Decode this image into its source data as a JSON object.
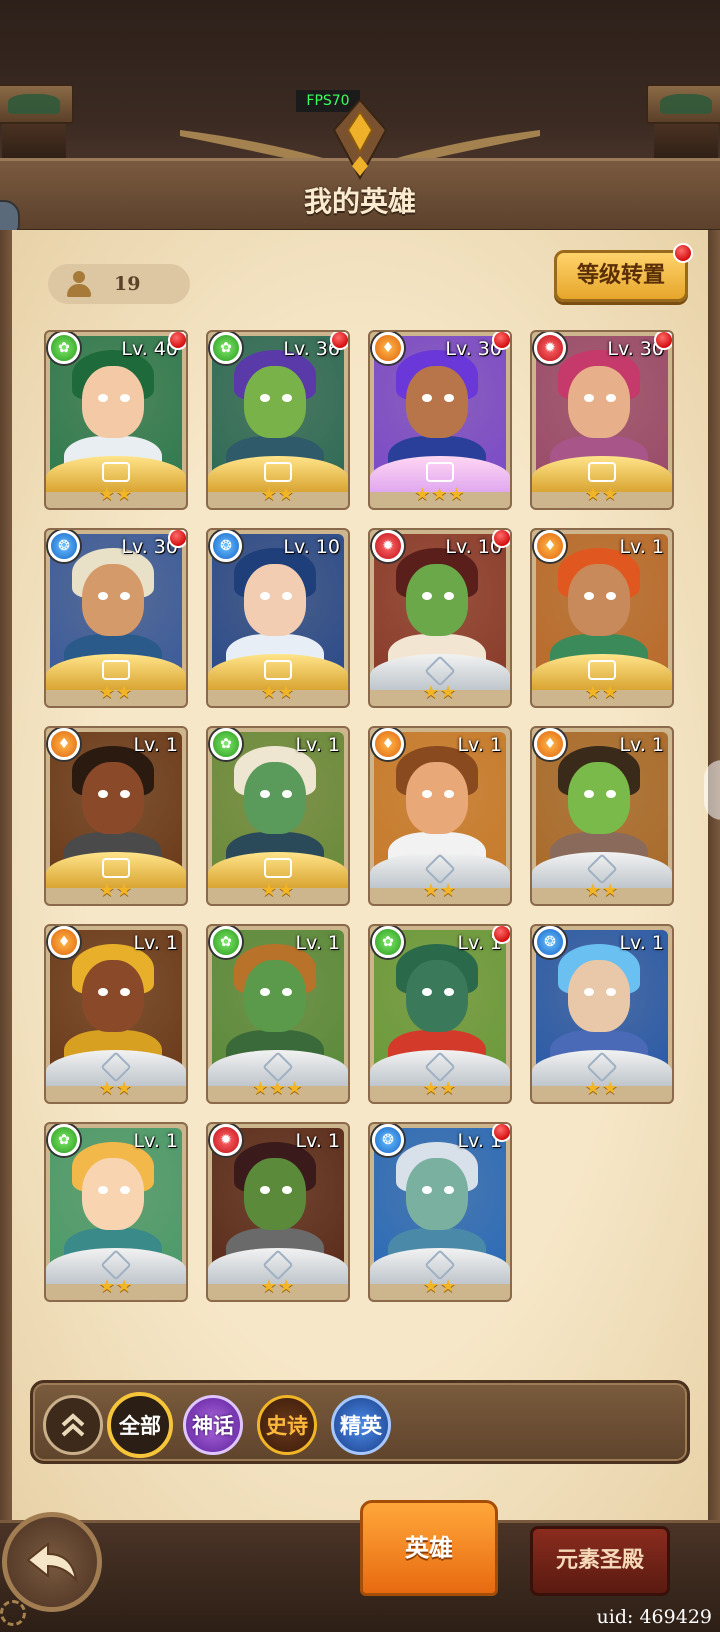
{
  "fps_label": "FPS70",
  "page_title": "我的英雄",
  "hero_count": "19",
  "level_reset_label": "等级转置",
  "heroes": [
    {
      "level": "Lv. 40",
      "element": "nature",
      "element_icon": "leaf-icon",
      "stars": "★★",
      "frame": "gold",
      "new_dot": true,
      "colors": {
        "bg": "#2f7a4f",
        "hair": "#1f6a3a",
        "face": "#f3c9a6",
        "body": "#e9eef2"
      }
    },
    {
      "level": "Lv. 36",
      "element": "nature",
      "element_icon": "leaf-icon",
      "stars": "★★",
      "frame": "gold",
      "new_dot": true,
      "colors": {
        "bg": "#2d6a56",
        "hair": "#5a3aa8",
        "face": "#7ab24a",
        "body": "#2f5a6a"
      }
    },
    {
      "level": "Lv. 30",
      "element": "fire",
      "element_icon": "flame-icon",
      "stars": "★★★",
      "frame": "pink",
      "new_dot": true,
      "colors": {
        "bg": "#7a4ac8",
        "hair": "#6a38d8",
        "face": "#b8754a",
        "body": "#2a3f9a"
      }
    },
    {
      "level": "Lv. 30",
      "element": "dark",
      "element_icon": "drop-icon",
      "stars": "★★",
      "frame": "gold",
      "new_dot": true,
      "colors": {
        "bg": "#9a4a6a",
        "hair": "#c53a6a",
        "face": "#e8b08a",
        "body": "#a8558a"
      }
    },
    {
      "level": "Lv. 30",
      "element": "water",
      "element_icon": "water-icon",
      "stars": "★★",
      "frame": "gold",
      "new_dot": true,
      "colors": {
        "bg": "#3a5a9a",
        "hair": "#e9e0c8",
        "face": "#d49a6a",
        "body": "#2a5a8a"
      }
    },
    {
      "level": "Lv. 10",
      "element": "water",
      "element_icon": "water-icon",
      "stars": "★★",
      "frame": "gold",
      "new_dot": false,
      "colors": {
        "bg": "#2a4a8a",
        "hair": "#1f3f7a",
        "face": "#f2cdb2",
        "body": "#e8eef5"
      }
    },
    {
      "level": "Lv. 10",
      "element": "dark",
      "element_icon": "drop-icon",
      "stars": "★★",
      "frame": "silver",
      "new_dot": true,
      "colors": {
        "bg": "#8a3a2a",
        "hair": "#5a1f1a",
        "face": "#6aa84a",
        "body": "#f2e6d2"
      }
    },
    {
      "level": "Lv. 1",
      "element": "fire",
      "element_icon": "flame-icon",
      "stars": "★★",
      "frame": "gold",
      "new_dot": false,
      "colors": {
        "bg": "#b86a2a",
        "hair": "#e0581f",
        "face": "#c88a5a",
        "body": "#3a8a5a"
      }
    },
    {
      "level": "Lv. 1",
      "element": "fire",
      "element_icon": "flame-icon",
      "stars": "★★",
      "frame": "gold",
      "new_dot": false,
      "colors": {
        "bg": "#6a3a1a",
        "hair": "#2a1a10",
        "face": "#8a4a2a",
        "body": "#4a4a4a"
      }
    },
    {
      "level": "Lv. 1",
      "element": "nature",
      "element_icon": "leaf-icon",
      "stars": "★★",
      "frame": "gold",
      "new_dot": false,
      "colors": {
        "bg": "#6a8a3a",
        "hair": "#efe6d2",
        "face": "#5a9a5a",
        "body": "#2a4a5a"
      }
    },
    {
      "level": "Lv. 1",
      "element": "fire",
      "element_icon": "flame-icon",
      "stars": "★★",
      "frame": "silver",
      "new_dot": false,
      "colors": {
        "bg": "#c87a2a",
        "hair": "#8a4a1f",
        "face": "#e8a878",
        "body": "#f2f2f2"
      }
    },
    {
      "level": "Lv. 1",
      "element": "fire",
      "element_icon": "flame-icon",
      "stars": "★★",
      "frame": "silver",
      "new_dot": false,
      "colors": {
        "bg": "#a86a2a",
        "hair": "#3a2a1a",
        "face": "#7aba4a",
        "body": "#8a6a5a"
      }
    },
    {
      "level": "Lv. 1",
      "element": "fire",
      "element_icon": "flame-icon",
      "stars": "★★",
      "frame": "silver",
      "new_dot": false,
      "colors": {
        "bg": "#6a3a1a",
        "hair": "#e8b02a",
        "face": "#8a4a2a",
        "body": "#d8a020"
      }
    },
    {
      "level": "Lv. 1",
      "element": "nature",
      "element_icon": "leaf-icon",
      "stars": "★★★",
      "frame": "silver",
      "new_dot": false,
      "colors": {
        "bg": "#5a8a3a",
        "hair": "#b8722a",
        "face": "#5a9a4a",
        "body": "#3a6a3a"
      }
    },
    {
      "level": "Lv. 1",
      "element": "nature",
      "element_icon": "leaf-icon",
      "stars": "★★",
      "frame": "silver",
      "new_dot": true,
      "colors": {
        "bg": "#6a9a3a",
        "hair": "#2a6a4a",
        "face": "#3a7a5a",
        "body": "#d43a2a"
      }
    },
    {
      "level": "Lv. 1",
      "element": "water",
      "element_icon": "water-icon",
      "stars": "★★",
      "frame": "silver",
      "new_dot": false,
      "colors": {
        "bg": "#2a5aa8",
        "hair": "#6ac0f0",
        "face": "#e8c8a8",
        "body": "#4a6ab8"
      }
    },
    {
      "level": "Lv. 1",
      "element": "nature",
      "element_icon": "leaf-icon",
      "stars": "★★",
      "frame": "silver",
      "new_dot": false,
      "colors": {
        "bg": "#4a9a6a",
        "hair": "#f2b84a",
        "face": "#f8d4b0",
        "body": "#3a8a8a"
      }
    },
    {
      "level": "Lv. 1",
      "element": "dark",
      "element_icon": "drop-icon",
      "stars": "★★",
      "frame": "silver",
      "new_dot": false,
      "colors": {
        "bg": "#5a2a1a",
        "hair": "#3a1a1a",
        "face": "#5a8a3a",
        "body": "#6a6a6a"
      }
    },
    {
      "level": "Lv. 1",
      "element": "water",
      "element_icon": "water-icon",
      "stars": "★★",
      "frame": "silver",
      "new_dot": true,
      "colors": {
        "bg": "#2a6ab8",
        "hair": "#d8e0ea",
        "face": "#7ab0a0",
        "body": "#4a8aa8"
      }
    }
  ],
  "filters": {
    "collapse_icon": "double-chevron-up-icon",
    "all": "全部",
    "mythic": "神话",
    "epic": "史诗",
    "elite": "精英"
  },
  "bottom": {
    "back_icon": "back-arrow-icon",
    "tab_heroes": "英雄",
    "tab_temple": "元素圣殿"
  },
  "uid": "uid: 469429"
}
